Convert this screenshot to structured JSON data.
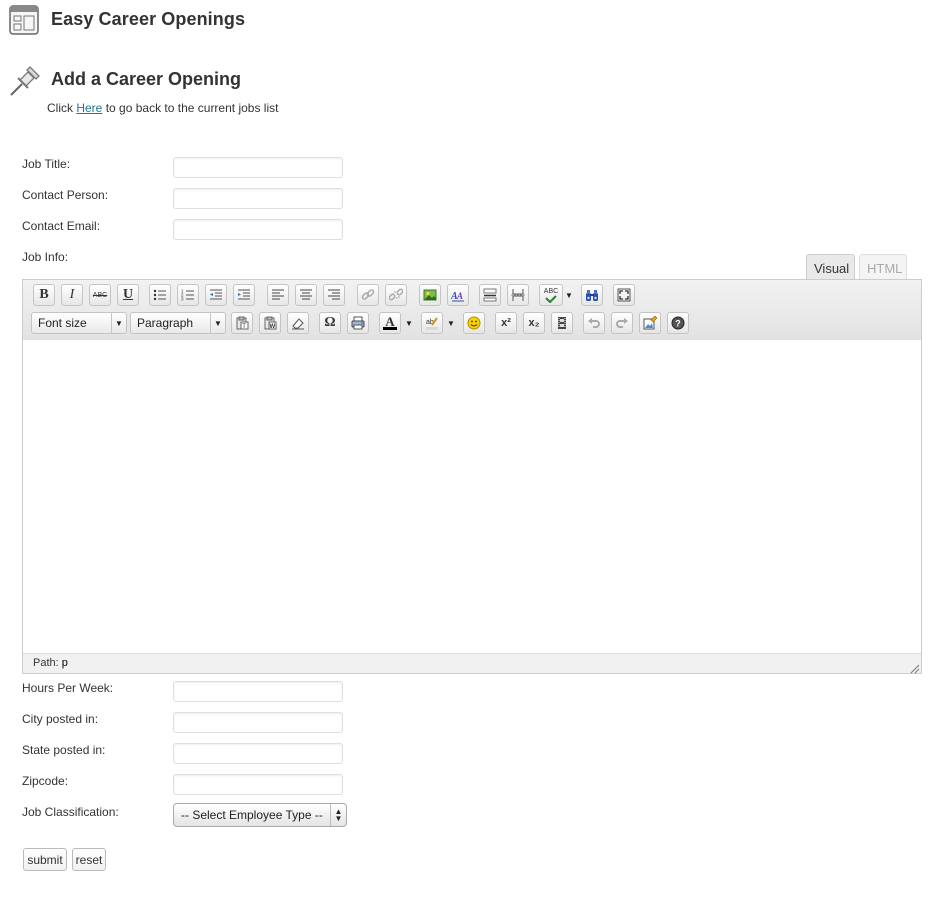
{
  "header": {
    "plugin_title": "Easy Career Openings",
    "page_title": "Add a Career Opening",
    "back_prefix": "Click",
    "back_link": "Here",
    "back_suffix": "to go back to the current jobs list"
  },
  "fields": {
    "job_title": "Job Title:",
    "contact_person": "Contact Person:",
    "contact_email": "Contact Email:",
    "job_info": "Job Info:",
    "hours": "Hours Per Week:",
    "city": "City posted in:",
    "state": "State posted in:",
    "zipcode": "Zipcode:",
    "classification": "Job Classification:"
  },
  "values": {
    "job_title": "",
    "contact_person": "",
    "contact_email": "",
    "hours": "",
    "city": "",
    "state": "",
    "zipcode": ""
  },
  "editor": {
    "tabs": {
      "visual": "Visual",
      "html": "HTML"
    },
    "active_tab": "Visual",
    "font_size_label": "Font size",
    "format_label": "Paragraph",
    "path_label": "Path:",
    "path_value": "p",
    "toolbar_row1": [
      "bold",
      "italic",
      "strikethrough",
      "underline",
      "bullet-list",
      "numbered-list",
      "outdent",
      "indent",
      "align-left",
      "align-center",
      "align-right",
      "link",
      "unlink",
      "insert-image",
      "style",
      "horizontal-rule",
      "page-break",
      "spellcheck",
      "find",
      "fullscreen"
    ],
    "toolbar_row2": [
      "paste-text",
      "paste-word",
      "remove-format",
      "special-char",
      "print",
      "text-color",
      "highlight-color",
      "emoticon",
      "superscript",
      "subscript",
      "media",
      "undo",
      "redo",
      "edit-image",
      "help"
    ],
    "glyphs": {
      "bold": "B",
      "italic": "I",
      "strike": "ABC",
      "underline": "U",
      "omega": "Ω",
      "text_color": "A",
      "spell": "ABC",
      "sup": "x²",
      "sub": "x₂"
    }
  },
  "classification_select": {
    "selected": "-- Select Employee Type --"
  },
  "buttons": {
    "submit": "submit",
    "reset": "reset"
  },
  "colors": {
    "link": "#21759b",
    "tab_inactive_text": "#aaaaaa",
    "title_text": "#333333"
  }
}
